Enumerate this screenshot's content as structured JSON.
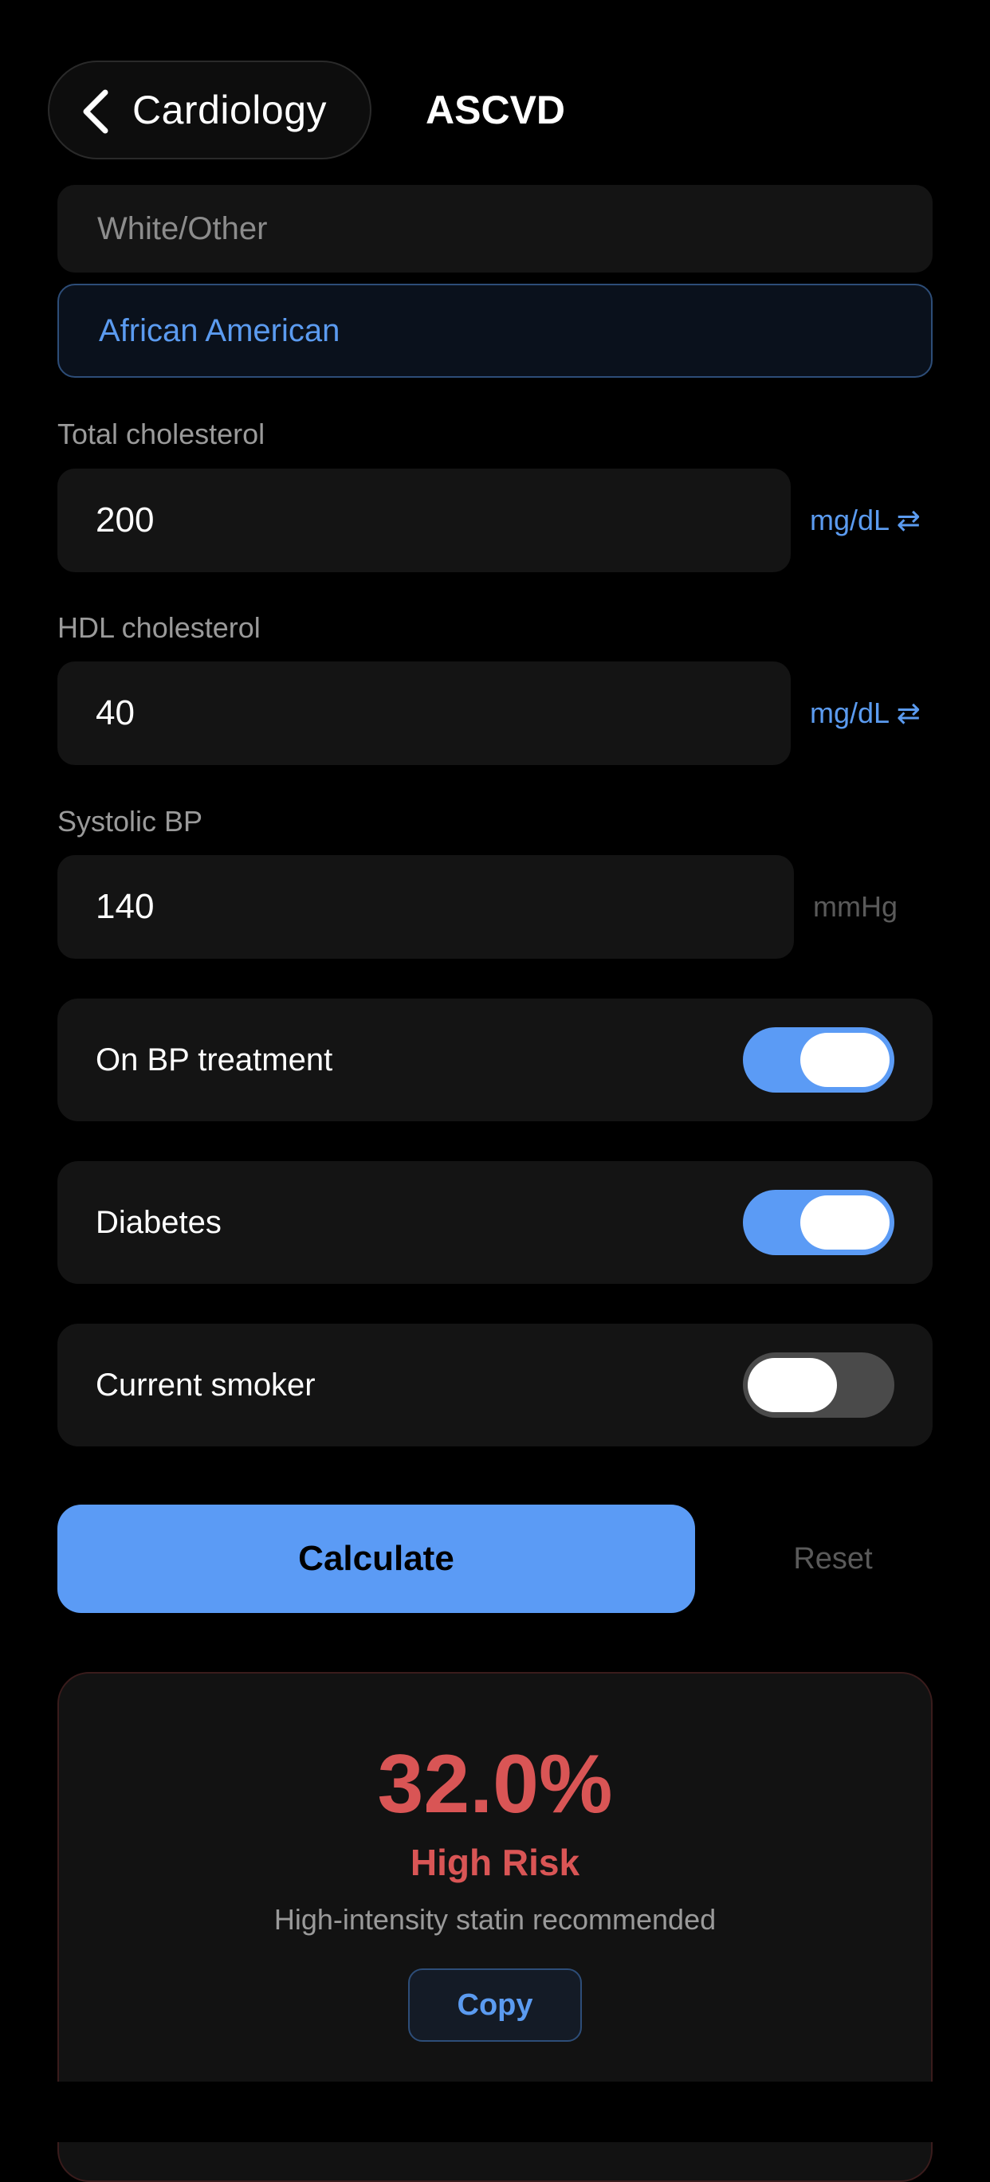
{
  "header": {
    "back_label": "Cardiology",
    "title": "ASCVD"
  },
  "race": {
    "options": [
      "White/Other",
      "African American"
    ],
    "selected": "African American"
  },
  "fields": {
    "total_cholesterol": {
      "label": "Total cholesterol",
      "value": "200",
      "unit": "mg/dL ⇄"
    },
    "hdl_cholesterol": {
      "label": "HDL cholesterol",
      "value": "40",
      "unit": "mg/dL ⇄"
    },
    "systolic_bp": {
      "label": "Systolic BP",
      "value": "140",
      "unit": "mmHg"
    }
  },
  "toggles": {
    "bp_treatment": {
      "label": "On BP treatment",
      "on": true
    },
    "diabetes": {
      "label": "Diabetes",
      "on": true
    },
    "smoker": {
      "label": "Current smoker",
      "on": false
    }
  },
  "actions": {
    "calculate_label": "Calculate",
    "reset_label": "Reset"
  },
  "result": {
    "value": "32.0%",
    "level": "High Risk",
    "recommendation": "High-intensity statin recommended",
    "copy_label": "Copy"
  },
  "icons": {
    "back": "chevron-left-icon",
    "unit_swap": "swap-arrows-icon"
  },
  "colors": {
    "accent": "#5b9bf5",
    "danger": "#d95555",
    "background": "#000000",
    "surface": "#141414"
  }
}
